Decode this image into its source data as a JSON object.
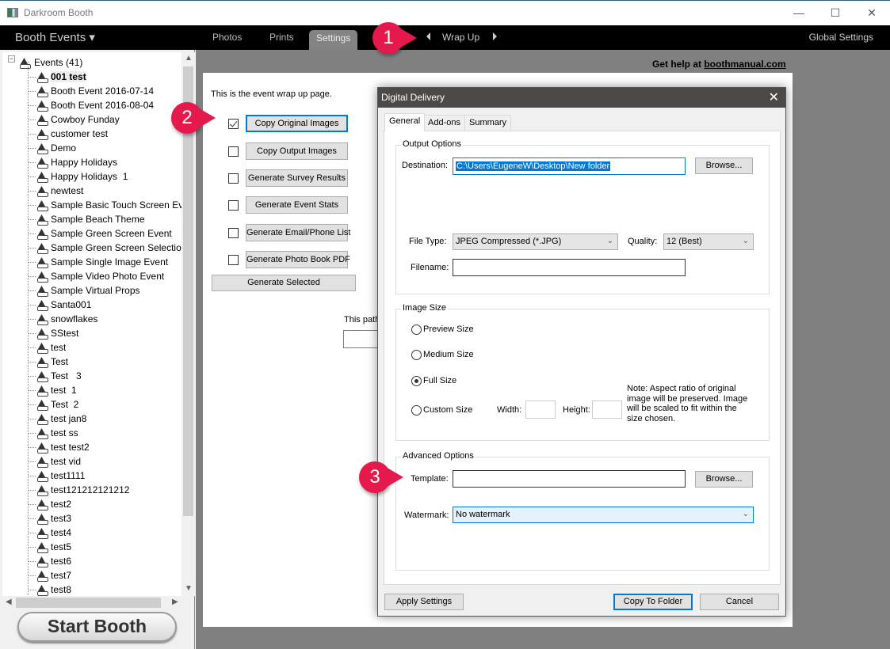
{
  "window": {
    "title": "Darkroom Booth",
    "controls": {
      "minimize": "—",
      "maximize": "☐",
      "close": "✕"
    }
  },
  "topbar": {
    "menu_label": "Booth Events ▾",
    "tabs": [
      {
        "label": "Photos",
        "active": false
      },
      {
        "label": "Prints",
        "active": false
      },
      {
        "label": "Settings",
        "active": true
      }
    ],
    "section": "Wrap Up",
    "global_settings": "Global Settings"
  },
  "sidebar": {
    "root": "Events (41)",
    "selected": "001 test",
    "events": [
      "001 test",
      "Booth Event 2016-07-14",
      "Booth Event 2016-08-04",
      "Cowboy Funday",
      "customer test",
      "Demo",
      "Happy Holidays",
      "Happy Holidays  1",
      "newtest",
      "Sample Basic Touch Screen Eve",
      "Sample Beach Theme",
      "Sample Green Screen Event",
      "Sample Green Screen Selection",
      "Sample Single Image Event",
      "Sample Video Photo Event",
      "Sample Virtual Props",
      "Santa001",
      "snowflakes",
      "SStest",
      "test",
      "Test",
      "Test   3",
      "test  1",
      "Test  2",
      "test jan8",
      "test ss",
      "test test2",
      "test vid",
      "test1111",
      "test121212121212",
      "test2",
      "test3",
      "test4",
      "test5",
      "test6",
      "test7",
      "test8"
    ],
    "start_button": "Start Booth"
  },
  "main": {
    "help_prefix": "Get help at ",
    "help_link": "boothmanual.com",
    "intro": "This is the event wrap up page.",
    "actions": [
      {
        "label": "Copy Original Images",
        "checked": true
      },
      {
        "label": "Copy Output Images",
        "checked": false
      },
      {
        "label": "Generate Survey Results",
        "checked": false
      },
      {
        "label": "Generate Event Stats",
        "checked": false
      },
      {
        "label": "Generate Email/Phone List",
        "checked": false
      },
      {
        "label": "Generate Photo Book PDF",
        "checked": false
      }
    ],
    "generate_selected": "Generate Selected",
    "path_label": "This path"
  },
  "dialog": {
    "title": "Digital Delivery",
    "tabs": [
      "General",
      "Add-ons",
      "Summary"
    ],
    "active_tab": "General",
    "output_options": {
      "legend": "Output Options",
      "destination_label": "Destination:",
      "destination_value": "C:\\Users\\EugeneW\\Desktop\\New folder",
      "browse": "Browse...",
      "file_type_label": "File Type:",
      "file_type_value": "JPEG Compressed (*.JPG)",
      "quality_label": "Quality:",
      "quality_value": "12 (Best)",
      "filename_label": "Filename:",
      "filename_value": ""
    },
    "image_size": {
      "legend": "Image Size",
      "options": [
        {
          "label": "Preview Size",
          "selected": false
        },
        {
          "label": "Medium Size",
          "selected": false
        },
        {
          "label": "Full Size",
          "selected": true
        },
        {
          "label": "Custom Size",
          "selected": false
        }
      ],
      "width_label": "Width:",
      "height_label": "Height:",
      "note": "Note: Aspect ratio of original image will be preserved. Image will be scaled to fit within the size chosen."
    },
    "advanced": {
      "legend": "Advanced Options",
      "template_label": "Template:",
      "template_value": "",
      "browse": "Browse...",
      "watermark_label": "Watermark:",
      "watermark_value": "No watermark"
    },
    "buttons": {
      "apply": "Apply Settings",
      "copy": "Copy To Folder",
      "cancel": "Cancel"
    }
  },
  "annotations": [
    "1",
    "2",
    "3"
  ],
  "colors": {
    "badge": "#e5194b",
    "focus": "#0078d7",
    "topbar": "#000000"
  }
}
